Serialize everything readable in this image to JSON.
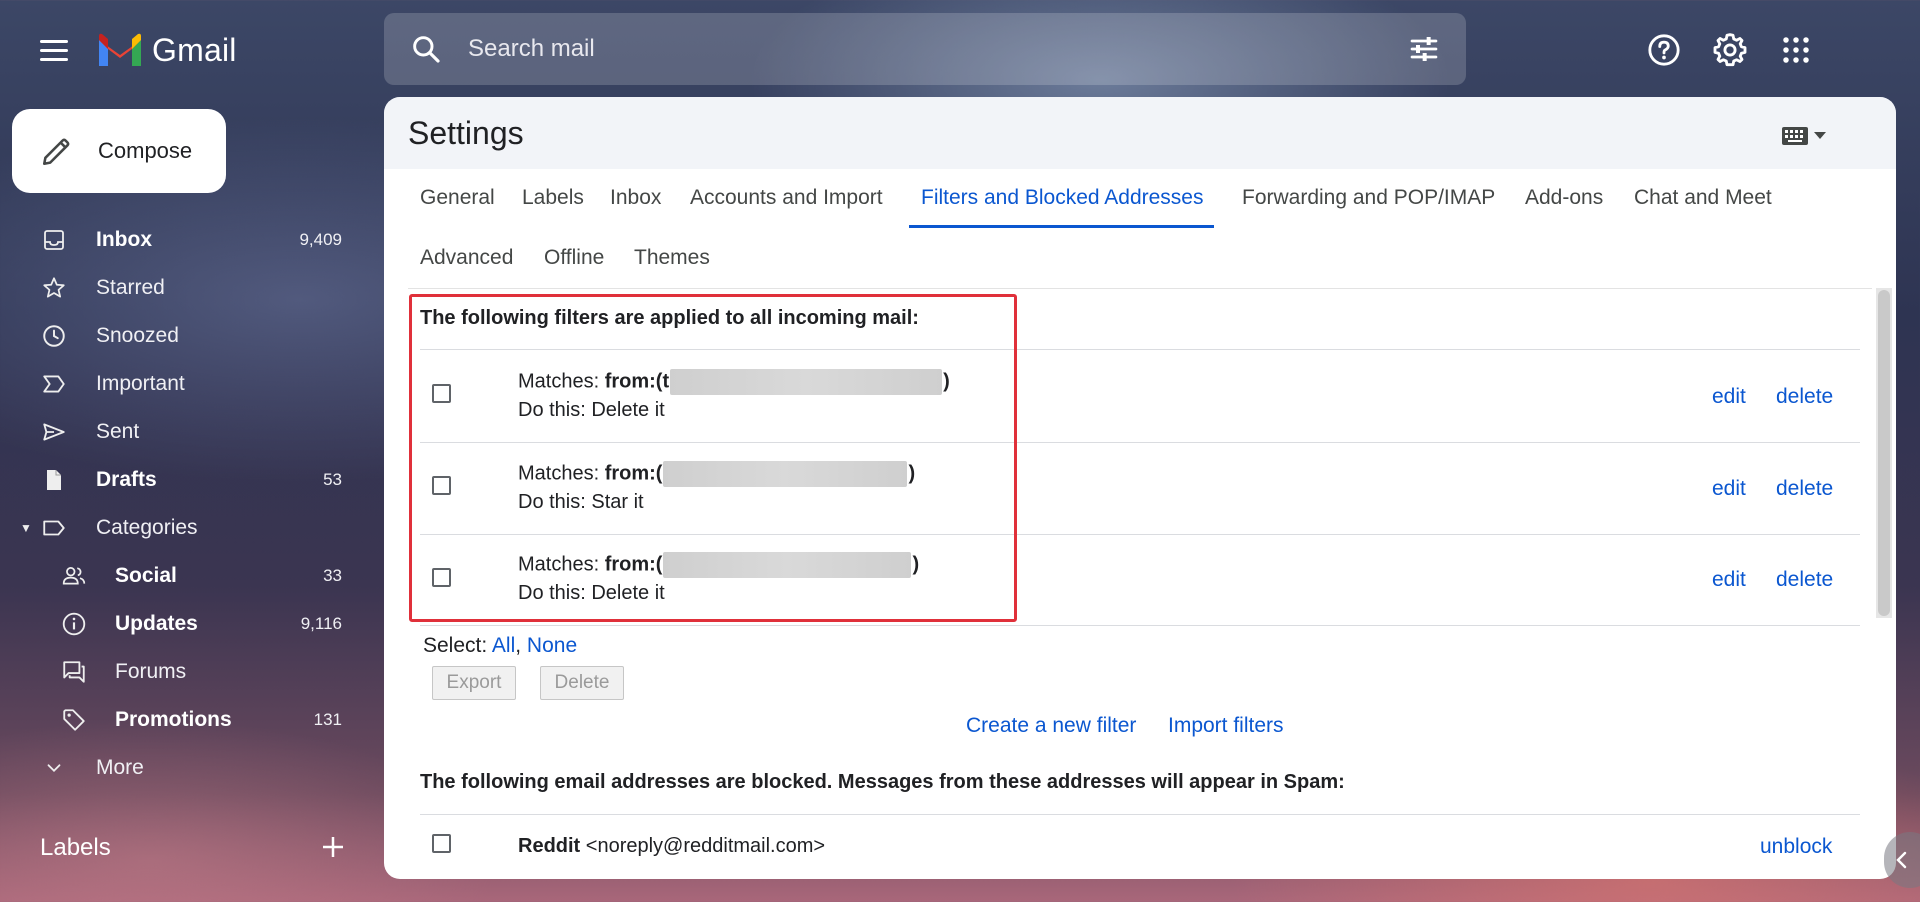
{
  "app": {
    "name": "Gmail"
  },
  "search": {
    "placeholder": "Search mail"
  },
  "compose": {
    "label": "Compose"
  },
  "sidebar": {
    "items": [
      {
        "name": "inbox",
        "label": "Inbox",
        "count": "9,409",
        "bold": true
      },
      {
        "name": "starred",
        "label": "Starred",
        "count": ""
      },
      {
        "name": "snoozed",
        "label": "Snoozed",
        "count": ""
      },
      {
        "name": "important",
        "label": "Important",
        "count": ""
      },
      {
        "name": "sent",
        "label": "Sent",
        "count": ""
      },
      {
        "name": "drafts",
        "label": "Drafts",
        "count": "53",
        "bold": true
      },
      {
        "name": "categories",
        "label": "Categories",
        "count": ""
      },
      {
        "name": "social",
        "label": "Social",
        "count": "33",
        "bold": true
      },
      {
        "name": "updates",
        "label": "Updates",
        "count": "9,116",
        "bold": true
      },
      {
        "name": "forums",
        "label": "Forums",
        "count": ""
      },
      {
        "name": "promotions",
        "label": "Promotions",
        "count": "131",
        "bold": true
      },
      {
        "name": "more",
        "label": "More",
        "count": ""
      }
    ],
    "labels_heading": "Labels"
  },
  "settings": {
    "title": "Settings",
    "tabs": [
      "General",
      "Labels",
      "Inbox",
      "Accounts and Import",
      "Filters and Blocked Addresses",
      "Forwarding and POP/IMAP",
      "Add-ons",
      "Chat and Meet",
      "Advanced",
      "Offline",
      "Themes"
    ],
    "active_tab": "Filters and Blocked Addresses",
    "filters_heading": "The following filters are applied to all incoming mail:",
    "filters": [
      {
        "matches_label": "Matches: ",
        "matches_key": "from:(",
        "matches_visible": "t",
        "close": ")",
        "action": "Do this: Delete it"
      },
      {
        "matches_label": "Matches: ",
        "matches_key": "from:(",
        "matches_visible": "",
        "close": ")",
        "action": "Do this: Star it"
      },
      {
        "matches_label": "Matches: ",
        "matches_key": "from:(",
        "matches_visible": "",
        "close": ")",
        "action": "Do this: Delete it"
      }
    ],
    "row_actions": {
      "edit": "edit",
      "delete": "delete"
    },
    "select": {
      "label": "Select: ",
      "all": "All",
      "comma": ",",
      "none": "None"
    },
    "buttons": {
      "export": "Export",
      "delete": "Delete"
    },
    "links": {
      "create_filter": "Create a new filter",
      "import_filters": "Import filters"
    },
    "blocked_heading": "The following email addresses are blocked. Messages from these addresses will appear in Spam:",
    "blocked": [
      {
        "name": "Reddit",
        "email": "<noreply@redditmail.com>",
        "action": "unblock"
      }
    ]
  },
  "colors": {
    "link": "#0b57d0",
    "highlight": "#e0303a"
  }
}
